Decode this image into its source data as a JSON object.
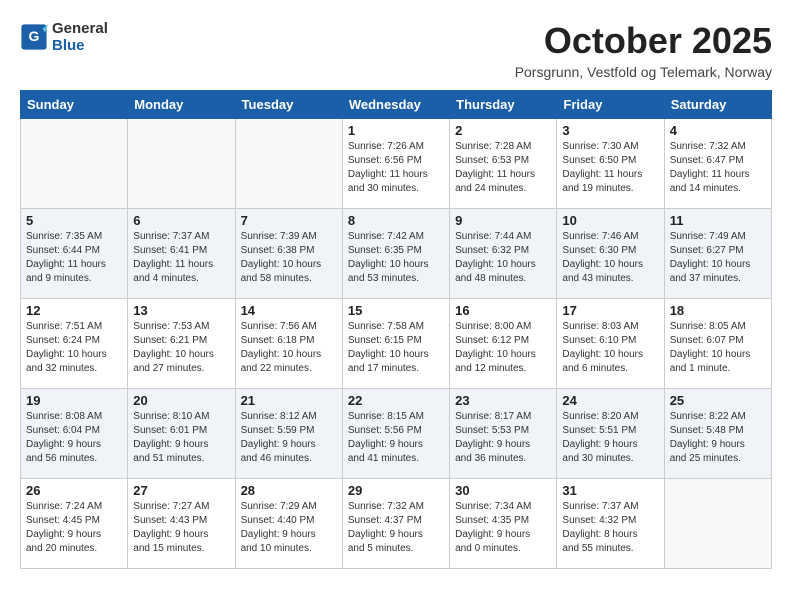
{
  "header": {
    "logo_line1": "General",
    "logo_line2": "Blue",
    "month_title": "October 2025",
    "location": "Porsgrunn, Vestfold og Telemark, Norway"
  },
  "weekdays": [
    "Sunday",
    "Monday",
    "Tuesday",
    "Wednesday",
    "Thursday",
    "Friday",
    "Saturday"
  ],
  "weeks": [
    [
      {
        "day": "",
        "info": ""
      },
      {
        "day": "",
        "info": ""
      },
      {
        "day": "",
        "info": ""
      },
      {
        "day": "1",
        "info": "Sunrise: 7:26 AM\nSunset: 6:56 PM\nDaylight: 11 hours\nand 30 minutes."
      },
      {
        "day": "2",
        "info": "Sunrise: 7:28 AM\nSunset: 6:53 PM\nDaylight: 11 hours\nand 24 minutes."
      },
      {
        "day": "3",
        "info": "Sunrise: 7:30 AM\nSunset: 6:50 PM\nDaylight: 11 hours\nand 19 minutes."
      },
      {
        "day": "4",
        "info": "Sunrise: 7:32 AM\nSunset: 6:47 PM\nDaylight: 11 hours\nand 14 minutes."
      }
    ],
    [
      {
        "day": "5",
        "info": "Sunrise: 7:35 AM\nSunset: 6:44 PM\nDaylight: 11 hours\nand 9 minutes."
      },
      {
        "day": "6",
        "info": "Sunrise: 7:37 AM\nSunset: 6:41 PM\nDaylight: 11 hours\nand 4 minutes."
      },
      {
        "day": "7",
        "info": "Sunrise: 7:39 AM\nSunset: 6:38 PM\nDaylight: 10 hours\nand 58 minutes."
      },
      {
        "day": "8",
        "info": "Sunrise: 7:42 AM\nSunset: 6:35 PM\nDaylight: 10 hours\nand 53 minutes."
      },
      {
        "day": "9",
        "info": "Sunrise: 7:44 AM\nSunset: 6:32 PM\nDaylight: 10 hours\nand 48 minutes."
      },
      {
        "day": "10",
        "info": "Sunrise: 7:46 AM\nSunset: 6:30 PM\nDaylight: 10 hours\nand 43 minutes."
      },
      {
        "day": "11",
        "info": "Sunrise: 7:49 AM\nSunset: 6:27 PM\nDaylight: 10 hours\nand 37 minutes."
      }
    ],
    [
      {
        "day": "12",
        "info": "Sunrise: 7:51 AM\nSunset: 6:24 PM\nDaylight: 10 hours\nand 32 minutes."
      },
      {
        "day": "13",
        "info": "Sunrise: 7:53 AM\nSunset: 6:21 PM\nDaylight: 10 hours\nand 27 minutes."
      },
      {
        "day": "14",
        "info": "Sunrise: 7:56 AM\nSunset: 6:18 PM\nDaylight: 10 hours\nand 22 minutes."
      },
      {
        "day": "15",
        "info": "Sunrise: 7:58 AM\nSunset: 6:15 PM\nDaylight: 10 hours\nand 17 minutes."
      },
      {
        "day": "16",
        "info": "Sunrise: 8:00 AM\nSunset: 6:12 PM\nDaylight: 10 hours\nand 12 minutes."
      },
      {
        "day": "17",
        "info": "Sunrise: 8:03 AM\nSunset: 6:10 PM\nDaylight: 10 hours\nand 6 minutes."
      },
      {
        "day": "18",
        "info": "Sunrise: 8:05 AM\nSunset: 6:07 PM\nDaylight: 10 hours\nand 1 minute."
      }
    ],
    [
      {
        "day": "19",
        "info": "Sunrise: 8:08 AM\nSunset: 6:04 PM\nDaylight: 9 hours\nand 56 minutes."
      },
      {
        "day": "20",
        "info": "Sunrise: 8:10 AM\nSunset: 6:01 PM\nDaylight: 9 hours\nand 51 minutes."
      },
      {
        "day": "21",
        "info": "Sunrise: 8:12 AM\nSunset: 5:59 PM\nDaylight: 9 hours\nand 46 minutes."
      },
      {
        "day": "22",
        "info": "Sunrise: 8:15 AM\nSunset: 5:56 PM\nDaylight: 9 hours\nand 41 minutes."
      },
      {
        "day": "23",
        "info": "Sunrise: 8:17 AM\nSunset: 5:53 PM\nDaylight: 9 hours\nand 36 minutes."
      },
      {
        "day": "24",
        "info": "Sunrise: 8:20 AM\nSunset: 5:51 PM\nDaylight: 9 hours\nand 30 minutes."
      },
      {
        "day": "25",
        "info": "Sunrise: 8:22 AM\nSunset: 5:48 PM\nDaylight: 9 hours\nand 25 minutes."
      }
    ],
    [
      {
        "day": "26",
        "info": "Sunrise: 7:24 AM\nSunset: 4:45 PM\nDaylight: 9 hours\nand 20 minutes."
      },
      {
        "day": "27",
        "info": "Sunrise: 7:27 AM\nSunset: 4:43 PM\nDaylight: 9 hours\nand 15 minutes."
      },
      {
        "day": "28",
        "info": "Sunrise: 7:29 AM\nSunset: 4:40 PM\nDaylight: 9 hours\nand 10 minutes."
      },
      {
        "day": "29",
        "info": "Sunrise: 7:32 AM\nSunset: 4:37 PM\nDaylight: 9 hours\nand 5 minutes."
      },
      {
        "day": "30",
        "info": "Sunrise: 7:34 AM\nSunset: 4:35 PM\nDaylight: 9 hours\nand 0 minutes."
      },
      {
        "day": "31",
        "info": "Sunrise: 7:37 AM\nSunset: 4:32 PM\nDaylight: 8 hours\nand 55 minutes."
      },
      {
        "day": "",
        "info": ""
      }
    ]
  ]
}
